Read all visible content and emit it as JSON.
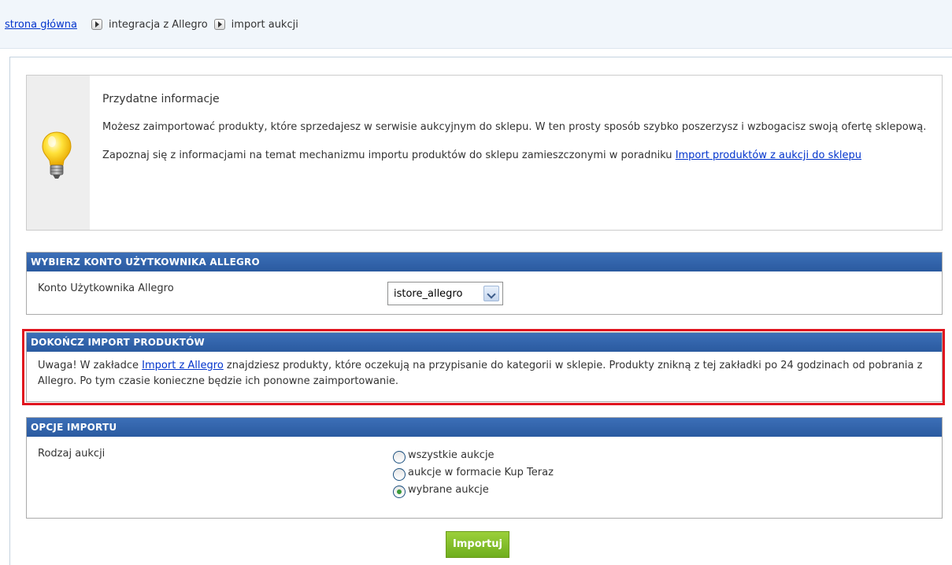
{
  "breadcrumb": {
    "home": "strona główna",
    "level1": "integracja z Allegro",
    "level2": "import aukcji"
  },
  "info": {
    "title": "Przydatne informacje",
    "para1": "Możesz zaimportować produkty, które sprzedajesz w serwisie aukcyjnym do sklepu. W ten prosty sposób szybko poszerzysz i wzbogacisz swoją ofertę sklepową.",
    "para2_prefix": "Zapoznaj się z informacjami na temat mechanizmu importu produktów do sklepu zamieszczonymi w poradniku ",
    "para2_link": "Import produktów z aukcji do sklepu",
    "icon": "lightbulb-icon"
  },
  "account": {
    "header": "WYBIERZ KONTO UŻYTKOWNIKA ALLEGRO",
    "label": "Konto Użytkownika Allegro",
    "selected": "istore_allegro"
  },
  "import": {
    "header": "DOKOŃCZ IMPORT PRODUKTÓW",
    "text_prefix": "Uwaga! W zakładce ",
    "link": "Import z Allegro",
    "text_suffix": " znajdziesz produkty, które oczekują na przypisanie do kategorii w sklepie. Produkty znikną z tej zakładki po 24 godzinach od pobrania z Allegro. Po tym czasie konieczne będzie ich ponowne zaimportowanie."
  },
  "options": {
    "header": "OPCJE IMPORTU",
    "label": "Rodzaj aukcji",
    "choices": [
      {
        "label": "wszystkie aukcje",
        "checked": false
      },
      {
        "label": "aukcje w formacie Kup Teraz",
        "checked": false
      },
      {
        "label": "wybrane aukcje",
        "checked": true
      }
    ]
  },
  "submit": {
    "label": "Importuj"
  },
  "colors": {
    "header_blue": "#2a5aa0",
    "link_blue": "#0033cc",
    "highlight_red": "#e0141e",
    "button_green": "#7dbb24"
  }
}
